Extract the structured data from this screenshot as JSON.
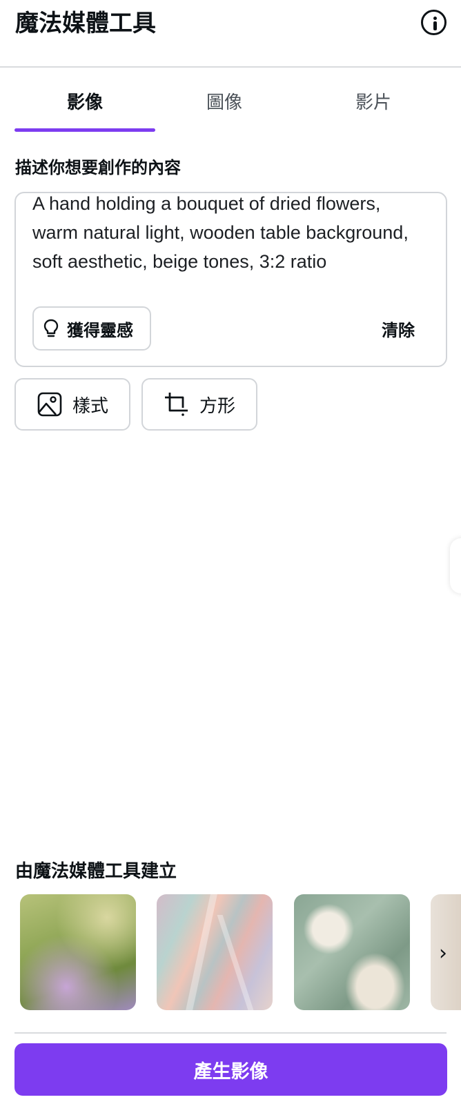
{
  "header": {
    "title": "魔法媒體工具",
    "info_icon": "info-icon"
  },
  "tabs": [
    {
      "label": "影像",
      "active": true
    },
    {
      "label": "圖像",
      "active": false
    },
    {
      "label": "影片",
      "active": false
    }
  ],
  "prompt": {
    "label": "描述你想要創作的內容",
    "value": "A hand holding a bouquet of dried flowers, warm natural light, wooden table background, soft aesthetic, beige tones, 3:2 ratio",
    "inspire_label": "獲得靈感",
    "inspire_icon": "lightbulb-icon",
    "clear_label": "清除"
  },
  "options": {
    "style_label": "樣式",
    "style_icon": "image-icon",
    "aspect_label": "方形",
    "aspect_icon": "crop-icon"
  },
  "examples": {
    "label": "由魔法媒體工具建立",
    "next_icon": "chevron-right-icon"
  },
  "generate": {
    "label": "產生影像"
  },
  "colors": {
    "accent": "#7d3cf0",
    "border": "#d2d5d9",
    "text": "#0d1216"
  }
}
